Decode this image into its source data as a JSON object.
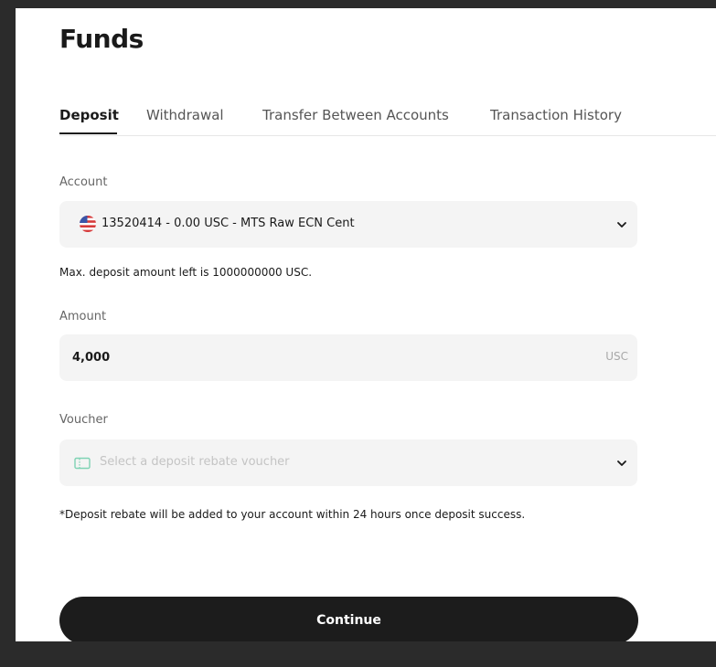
{
  "page": {
    "title": "Funds"
  },
  "tabs": [
    {
      "label": "Deposit",
      "active": true
    },
    {
      "label": "Withdrawal",
      "active": false
    },
    {
      "label": "Transfer Between Accounts",
      "active": false
    },
    {
      "label": "Transaction History",
      "active": false
    }
  ],
  "account": {
    "label": "Account",
    "selected": "13520414 - 0.00 USC - MTS Raw ECN Cent",
    "flag_icon": "us-flag-icon",
    "max_note": "Max. deposit amount left is 1000000000 USC."
  },
  "amount": {
    "label": "Amount",
    "value": "4,000",
    "currency": "USC"
  },
  "voucher": {
    "label": "Voucher",
    "placeholder": "Select a deposit rebate voucher",
    "icon": "ticket-icon",
    "note": "*Deposit rebate will be added to your account within 24 hours once deposit success."
  },
  "actions": {
    "continue_label": "Continue"
  },
  "colors": {
    "primary_button": "#1c1c1c",
    "field_background": "#f4f4f4",
    "voucher_icon": "#7fd3b4",
    "flag_red": "#d63a3a",
    "flag_blue": "#3a55a8"
  }
}
